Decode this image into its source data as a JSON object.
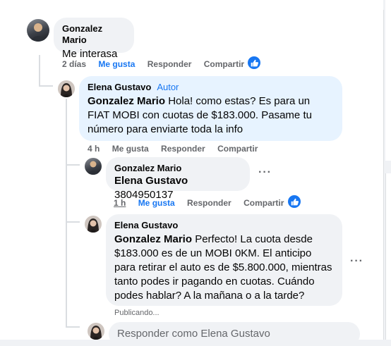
{
  "comments": [
    {
      "author": "Gonzalez Mario",
      "badge": "",
      "mention": "",
      "text": "Me interasa",
      "time": "2 días",
      "like": "Me gusta",
      "reply": "Responder",
      "share": "Compartir",
      "has_reaction": true
    },
    {
      "author": "Elena Gustavo",
      "badge": "Autor",
      "mention": "Gonzalez Mario",
      "text": " Hola! como estas? Es para un FIAT MOBI con cuotas de $183.000. Pasame tu número para enviarte toda la info",
      "time": "4 h",
      "like": "Me gusta",
      "reply": "Responder",
      "share": "Compartir",
      "has_reaction": false
    },
    {
      "author": "Gonzalez Mario",
      "badge": "",
      "mention": "Elena Gustavo",
      "text": " 3804950137",
      "time": "1 h",
      "like": "Me gusta",
      "reply": "Responder",
      "share": "Compartir",
      "has_reaction": true
    },
    {
      "author": "Elena Gustavo",
      "badge": "",
      "mention": "Gonzalez Mario",
      "text": " Perfecto! La cuota desde $183.000 es de un MOBI 0KM. El anticipo para retirar el auto es de $5.800.000, mientras tanto podes ir pagando en cuotas. Cuándo podes hablar? A la mañana o a la tarde?",
      "status": "Publicando..."
    }
  ],
  "reply_box": {
    "placeholder": "Responder como Elena Gustavo"
  },
  "icons": {
    "reaction": "thumbs-up-icon",
    "more": "more-options-icon"
  },
  "colors": {
    "accent": "#1877f2",
    "bubble": "#f0f2f5",
    "author_bubble": "#e7f3ff",
    "meta": "#65676b"
  }
}
